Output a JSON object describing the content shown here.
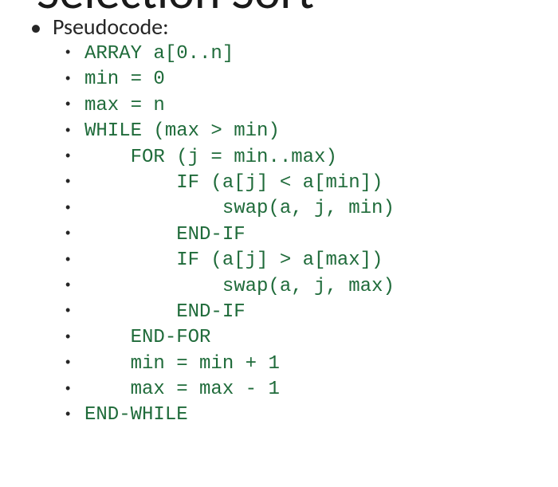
{
  "title": "Selection Sort",
  "heading": "Pseudocode:",
  "code_color": "#1F6B3A",
  "lines": [
    {
      "indent": 0,
      "text": "ARRAY a[0..n]"
    },
    {
      "indent": 0,
      "text": "min = 0"
    },
    {
      "indent": 0,
      "text": "max = n"
    },
    {
      "indent": 0,
      "text": "WHILE (max > min)"
    },
    {
      "indent": 1,
      "text": "FOR (j = min..max)"
    },
    {
      "indent": 2,
      "text": "IF (a[j] < a[min])"
    },
    {
      "indent": 3,
      "text": "swap(a, j, min)"
    },
    {
      "indent": 2,
      "text": "END-IF"
    },
    {
      "indent": 2,
      "text": "IF (a[j] > a[max])"
    },
    {
      "indent": 3,
      "text": "swap(a, j, max)"
    },
    {
      "indent": 2,
      "text": "END-IF"
    },
    {
      "indent": 1,
      "text": "END-FOR"
    },
    {
      "indent": 1,
      "text": "min = min + 1"
    },
    {
      "indent": 1,
      "text": "max = max - 1"
    },
    {
      "indent": 0,
      "text": "END-WHILE"
    }
  ],
  "indent_unit": "    "
}
